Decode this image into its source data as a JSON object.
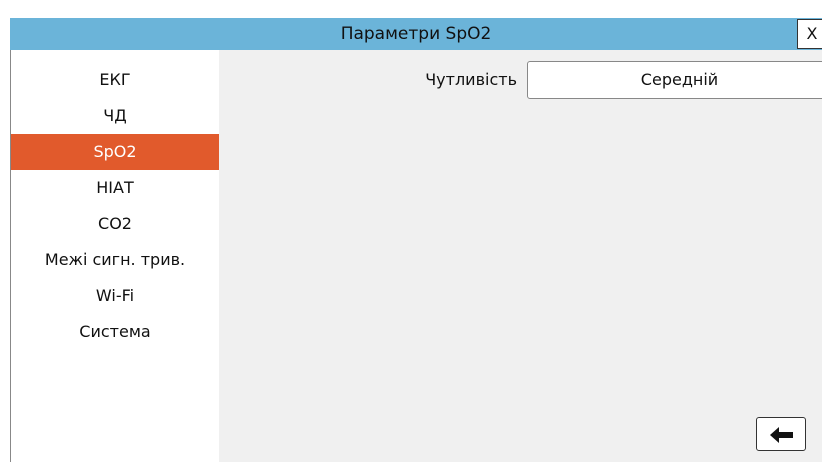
{
  "header": {
    "title": "Параметри SpO2",
    "close_label": "X"
  },
  "sidebar": {
    "active_index": 2,
    "items": [
      {
        "label": "ЕКГ"
      },
      {
        "label": "ЧД"
      },
      {
        "label": "SpO2"
      },
      {
        "label": "НІАТ"
      },
      {
        "label": "CO2"
      },
      {
        "label": "Межі сигн. трив."
      },
      {
        "label": "Wi-Fi"
      },
      {
        "label": "Система"
      }
    ]
  },
  "settings": {
    "sensitivity_label": "Чутливість",
    "sensitivity_value": "Середній"
  },
  "footer": {
    "back_icon": "arrow-left-icon"
  },
  "colors": {
    "header_bg": "#6bb4d9",
    "active_item_bg": "#e15a2c",
    "content_bg": "#f0f0f0"
  }
}
